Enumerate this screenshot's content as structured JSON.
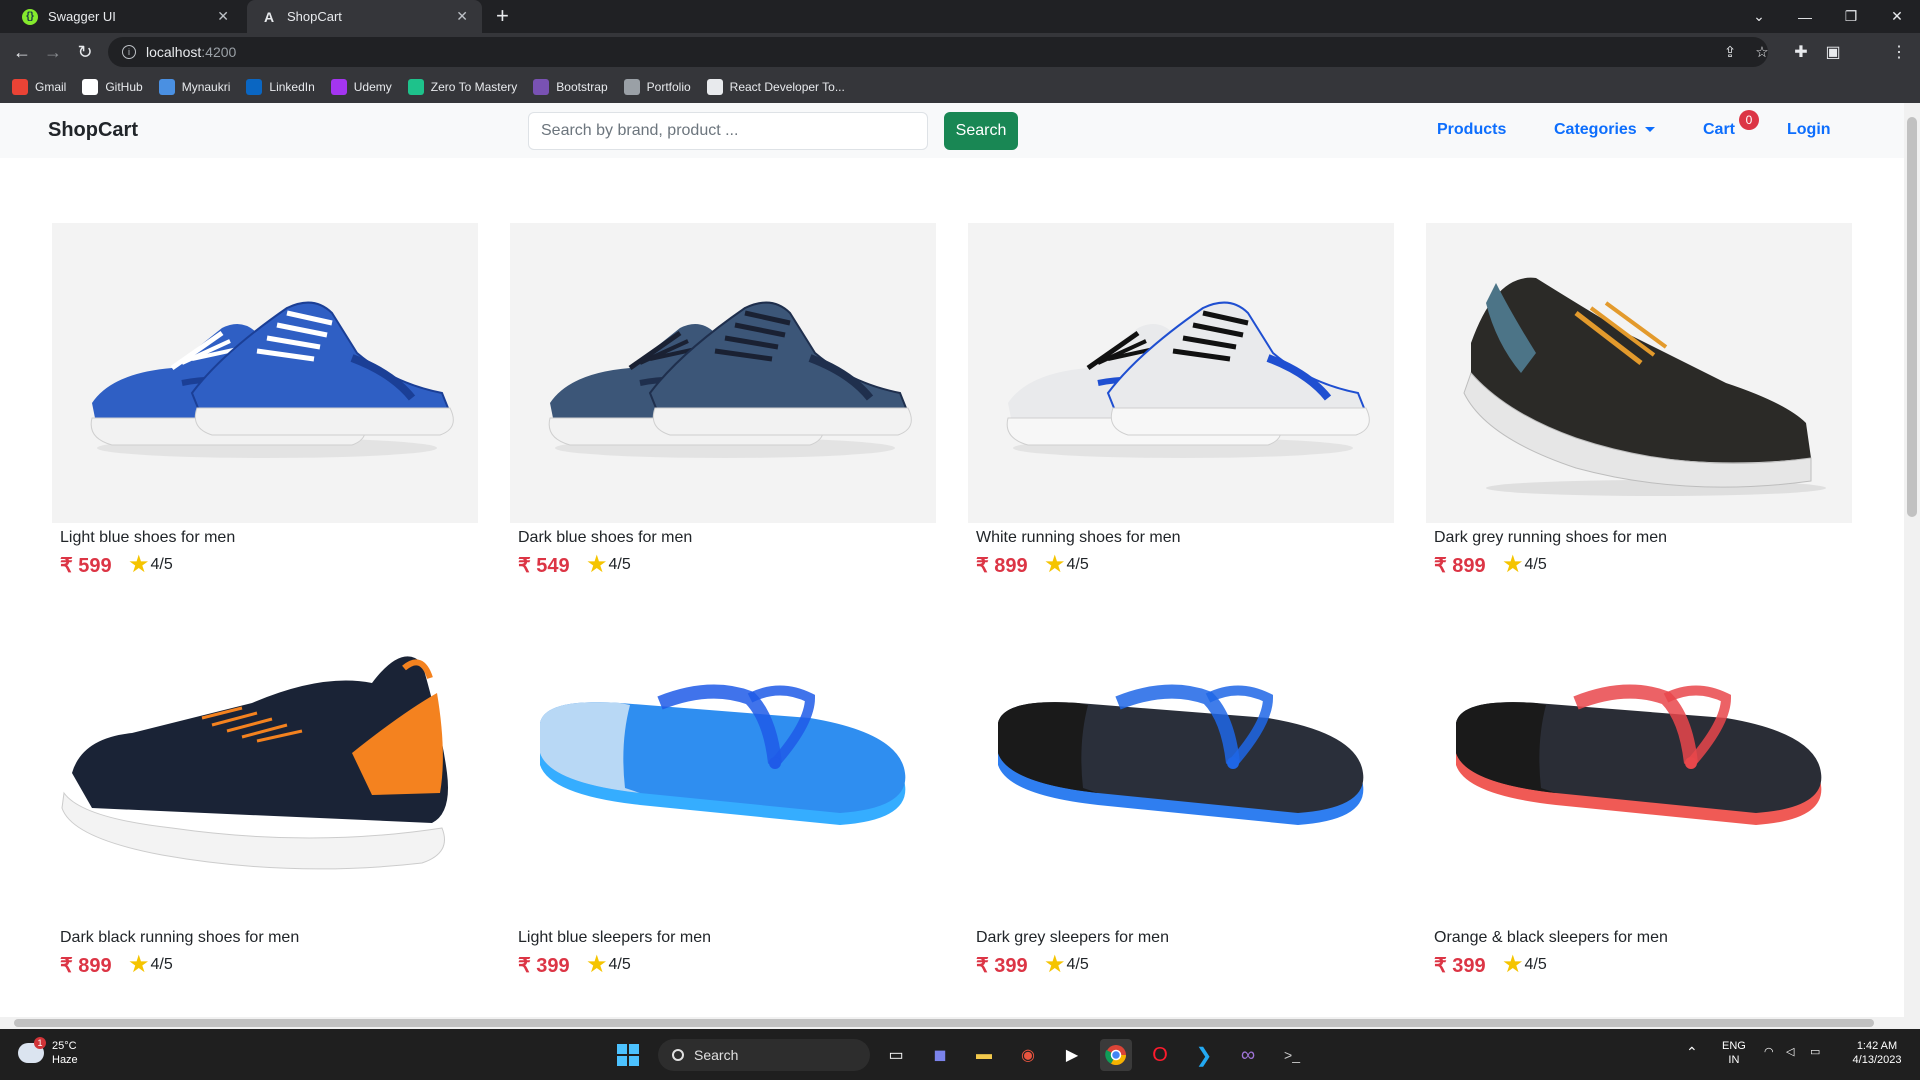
{
  "browser": {
    "tabs": [
      {
        "title": "Swagger UI",
        "icon": "swagger-icon"
      },
      {
        "title": "ShopCart",
        "icon": "angular-icon"
      }
    ],
    "address": {
      "host": "localhost",
      "port": ":4200"
    },
    "bookmarks": [
      {
        "label": "Gmail",
        "icon": "gmail-icon",
        "color": "#ea4335"
      },
      {
        "label": "GitHub",
        "icon": "github-icon",
        "color": "#ffffff"
      },
      {
        "label": "Mynaukri",
        "icon": "naukri-icon",
        "color": "#4a90e2"
      },
      {
        "label": "LinkedIn",
        "icon": "linkedin-icon",
        "color": "#0a66c2"
      },
      {
        "label": "Udemy",
        "icon": "udemy-icon",
        "color": "#a435f0"
      },
      {
        "label": "Zero To Mastery",
        "icon": "ztm-icon",
        "color": "#1ec28b"
      },
      {
        "label": "Bootstrap",
        "icon": "bootstrap-icon",
        "color": "#7952b3"
      },
      {
        "label": "Portfolio",
        "icon": "globe-icon",
        "color": "#9aa0a6"
      },
      {
        "label": "React Developer To...",
        "icon": "react-devtools-icon",
        "color": "#e8eaed"
      }
    ]
  },
  "app": {
    "brand": "ShopCart",
    "search": {
      "placeholder": "Search by brand, product ...",
      "button": "Search"
    },
    "nav": {
      "products": "Products",
      "categories": "Categories",
      "cart": "Cart",
      "cart_count": "0",
      "login": "Login"
    },
    "currency": "₹",
    "products": [
      {
        "name": "Light blue shoes for men",
        "price": "₹ 599",
        "rating": "4/5",
        "image": "shoe",
        "colors": {
          "upper": "#2f5fc4",
          "accent": "#1b3f96",
          "sole": "#f2f2f2",
          "lace": "#ffffff"
        }
      },
      {
        "name": "Dark blue shoes for men",
        "price": "₹ 549",
        "rating": "4/5",
        "image": "shoe",
        "colors": {
          "upper": "#3c5678",
          "accent": "#1f2f4d",
          "sole": "#f2f2f2",
          "lace": "#1a2133"
        }
      },
      {
        "name": "White running shoes for men",
        "price": "₹ 899",
        "rating": "4/5",
        "image": "shoe",
        "colors": {
          "upper": "#e9eaec",
          "accent": "#1f4fd1",
          "sole": "#f7f7f7",
          "lace": "#111111"
        }
      },
      {
        "name": "Dark grey running shoes for men",
        "price": "₹ 899",
        "rating": "4/5",
        "image": "side-shoe",
        "colors": {
          "upper": "#2b2a27",
          "accent": "#4c7487",
          "sole": "#e6e6e6",
          "lace": "#e39a2c"
        }
      },
      {
        "name": "Dark black running shoes for men",
        "price": "₹ 899",
        "rating": "4/5",
        "image": "side-shoe-white",
        "colors": {
          "upper": "#1a2336",
          "accent": "#f4821f",
          "sole": "#f3f3f3",
          "lace": "#f4821f"
        }
      },
      {
        "name": "Light blue sleepers for men",
        "price": "₹ 399",
        "rating": "4/5",
        "image": "slipper",
        "colors": {
          "upper": "#2f8ef0",
          "accent": "#1f5be8",
          "sole": "#35adff",
          "lace": "#b8d8f5"
        }
      },
      {
        "name": "Dark grey sleepers for men",
        "price": "₹ 399",
        "rating": "4/5",
        "image": "slipper",
        "colors": {
          "upper": "#2a2f3a",
          "accent": "#1e66e6",
          "sole": "#2f7ef0",
          "lace": "#1a1a1a"
        }
      },
      {
        "name": "Orange & black sleepers for men",
        "price": "₹ 399",
        "rating": "4/5",
        "image": "slipper",
        "colors": {
          "upper": "#2a2d36",
          "accent": "#e9474b",
          "sole": "#f05a55",
          "lace": "#1a1a1a"
        }
      }
    ]
  },
  "taskbar": {
    "weather": {
      "temp": "25°C",
      "desc": "Haze",
      "badge": "1"
    },
    "search": "Search",
    "lang": {
      "line1": "ENG",
      "line2": "IN"
    },
    "time": "1:42 AM",
    "date": "4/13/2023"
  }
}
